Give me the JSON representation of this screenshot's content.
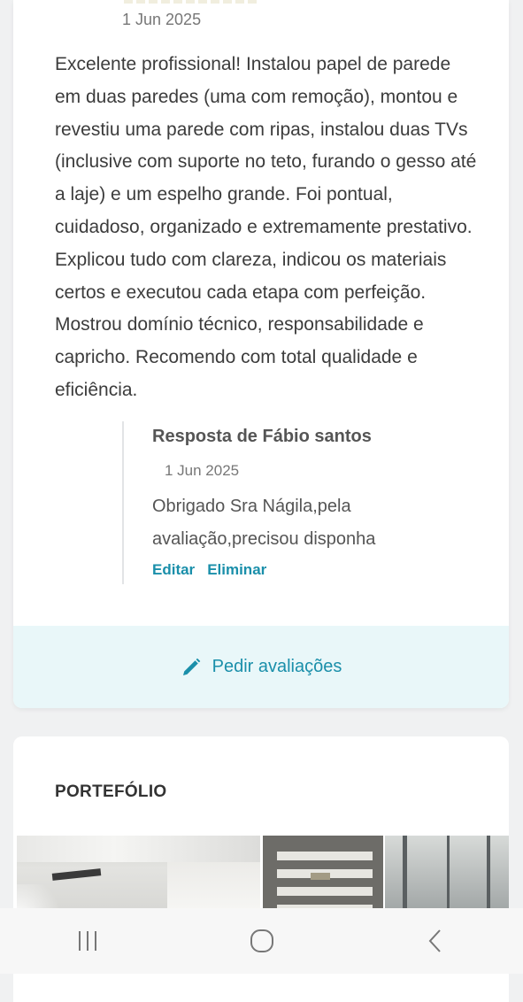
{
  "review": {
    "date": "1 Jun 2025",
    "text": "Excelente profissional! Instalou papel de parede em duas paredes (uma com remoção), montou e revestiu uma parede com ripas, instalou duas TVs (inclusive com suporte no teto, furando o gesso até a laje) e um espelho grande. Foi pontual, cuidadoso, organizado e extremamente prestativo. Explicou tudo com clareza, indicou os materiais certos e executou cada etapa com perfeição. Mostrou domínio técnico, responsabilidade e capricho. Recomendo com total qualidade e eficiência."
  },
  "reply": {
    "title": "Resposta de Fábio santos",
    "date": "1 Jun 2025",
    "text": "Obrigado Sra Nágila,pela avaliação,precisou disponha",
    "edit_label": "Editar",
    "delete_label": "Eliminar"
  },
  "request_reviews": {
    "label": "Pedir avaliações",
    "icon": "pencil-icon"
  },
  "portfolio": {
    "title": "PORTEFÓLIO",
    "thumbnails": [
      "portfolio-photo-1",
      "portfolio-photo-2",
      "portfolio-photo-3"
    ]
  },
  "navigation": {
    "recent_icon": "recent-apps-icon",
    "home_icon": "home-icon",
    "back_icon": "back-icon"
  },
  "colors": {
    "accent": "#1a8faa",
    "request_bar_bg": "#e9f7f9",
    "page_bg": "#f0f1f2"
  }
}
